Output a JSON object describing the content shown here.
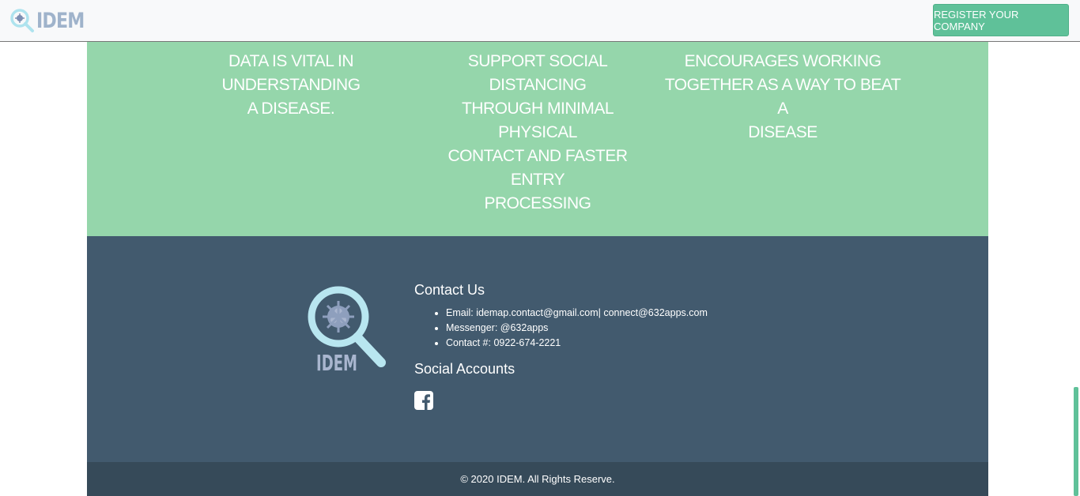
{
  "navbar": {
    "brand_name": "IDEM",
    "register_label": "REGISTER YOUR COMPANY"
  },
  "features": [
    {
      "text": "DATA IS VITAL IN\nUNDERSTANDING\nA DISEASE."
    },
    {
      "text": "SUPPORT SOCIAL DISTANCING\nTHROUGH MINIMAL PHYSICAL\nCONTACT AND FASTER ENTRY\nPROCESSING"
    },
    {
      "text": "ENCOURAGES WORKING\nTOGETHER AS A WAY TO BEAT A\nDISEASE"
    }
  ],
  "footer": {
    "logo_text": "IDEM",
    "contact_heading": "Contact Us",
    "contact_items": [
      "Email: idemap.contact@gmail.com| connect@632apps.com",
      "Messenger: @632apps",
      "Contact #: 0922-674-2221"
    ],
    "social_heading": "Social Accounts",
    "social_icons": [
      "facebook-icon"
    ],
    "copyright": "© 2020 IDEM. All Rights Reserve."
  },
  "colors": {
    "accent": "#5fc199",
    "feature_bg": "#95d6ab",
    "footer_bg": "#425a6e",
    "copyright_bg": "#364a59",
    "brand_text": "#9fb3cb"
  }
}
